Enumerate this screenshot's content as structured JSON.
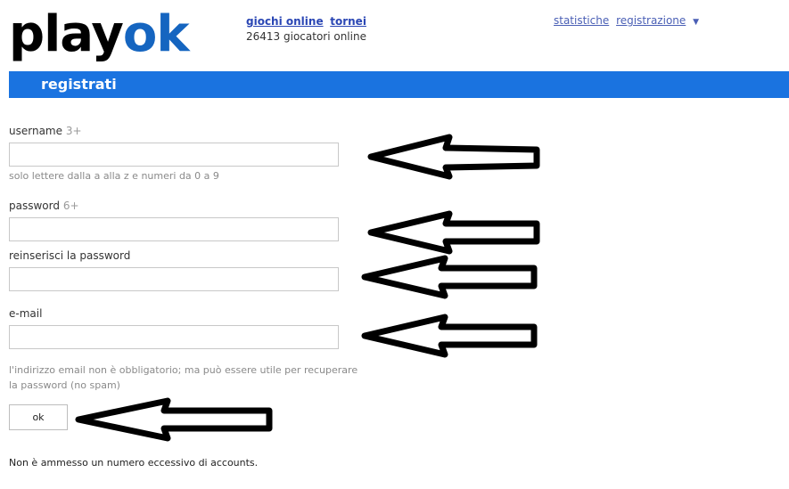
{
  "logo": {
    "part1": "play",
    "part2": "ok"
  },
  "nav": {
    "games_link": "giochi online",
    "tournaments_link": "tornei",
    "online_count": "26413 giocatori online",
    "stats_link": "statistiche",
    "register_link": "registrazione",
    "caret": "▼"
  },
  "header": {
    "title": "registrati"
  },
  "form": {
    "username_label": "username",
    "username_req": "3+",
    "username_value": "",
    "username_hint": "solo lettere dalla a alla z e numeri da 0 a 9",
    "password_label": "password",
    "password_req": "6+",
    "password_value": "",
    "repassword_label": "reinserisci la password",
    "repassword_value": "",
    "email_label": "e-mail",
    "email_value": "",
    "email_hint_line1": "l'indirizzo email non è obbligatorio; ma può essere utile per recuperare",
    "email_hint_line2": "la password (no spam)",
    "submit_label": "ok"
  },
  "footer": {
    "notice": "Non è ammesso un numero eccessivo di accounts."
  },
  "colors": {
    "brand_blue": "#1a73e0",
    "logo_blue": "#1565c0",
    "link_blue": "#2a46b4"
  },
  "annotations": [
    "arrow-icon",
    "arrow-icon",
    "arrow-icon",
    "arrow-icon",
    "arrow-icon"
  ]
}
